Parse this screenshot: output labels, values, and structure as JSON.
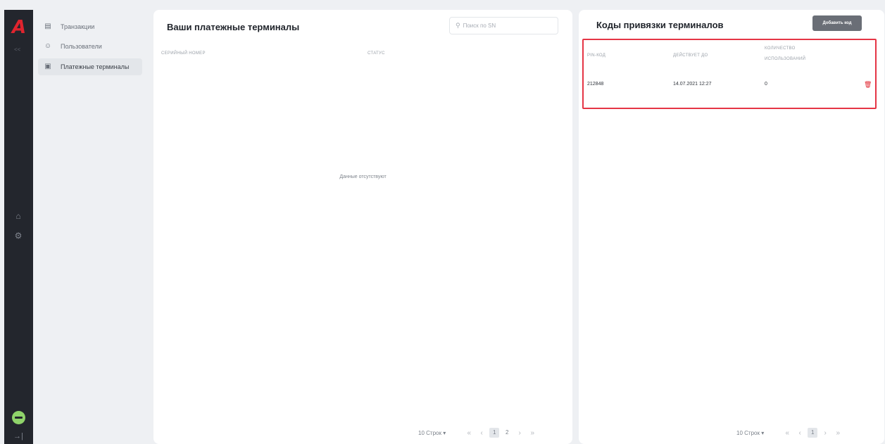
{
  "rail": {
    "logo": "A",
    "collapse": "<<",
    "icons": [
      "home-icon",
      "settings-icon",
      "logout-icon"
    ]
  },
  "sidebar": {
    "items": [
      {
        "label": "Транзакции",
        "icon": "document-icon",
        "active": false
      },
      {
        "label": "Пользователи",
        "icon": "users-icon",
        "active": false
      },
      {
        "label": "Платежные терминалы",
        "icon": "terminal-icon",
        "active": true
      }
    ]
  },
  "terminals": {
    "title": "Ваши платежные терминалы",
    "search_placeholder": "Поиск по SN",
    "columns": [
      "Серийный номер",
      "Статус"
    ],
    "empty_text": "Данные отсутствуют",
    "pager": {
      "rows": "10 Строк",
      "pages": [
        "1",
        "2"
      ],
      "current": "1"
    }
  },
  "codes": {
    "title": "Коды привязки терминалов",
    "add_label": "Добавить код",
    "columns": [
      "PIN-код",
      "Действует до",
      "Количество",
      "использований"
    ],
    "rows": [
      {
        "pin": "212848",
        "valid_until": "14.07.2021 12:27",
        "uses": "0"
      }
    ],
    "pager": {
      "rows": "10 Строк",
      "pages": [
        "1"
      ],
      "current": "1"
    }
  },
  "colors": {
    "accent": "#e0242e",
    "highlight": "#e53545",
    "rail": "#23262d",
    "avatar": "#8fd36a",
    "button": "#6a6e76"
  }
}
